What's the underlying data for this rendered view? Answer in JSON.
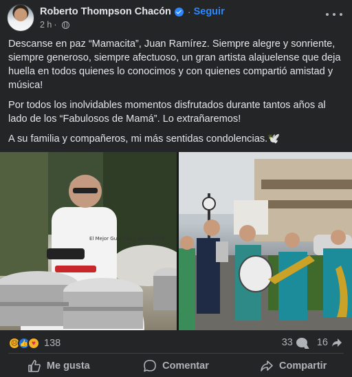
{
  "post": {
    "author": "Roberto Thompson Chacón",
    "follow_label": "Seguir",
    "time": "2 h",
    "separator": "·",
    "paragraphs": [
      "Descanse en paz “Mamacita”, Juan Ramírez. Siempre alegre y sonriente, siempre generoso, siempre afectuoso, un gran artista alajuelense que deja huella en todos quienes lo conocimos y con quienes compartió amistad y música!",
      "Por todos los inolvidables momentos disfrutados durante tantos años al lado de los “Fabulosos de Mamá”.  Lo extrañaremos!",
      "A su familia y compañeros, mi más sentidas condolencias.🕊️"
    ]
  },
  "photos": {
    "left_shirt_text": "El Mejor Guardián Infantil 2020"
  },
  "stats": {
    "reaction_count": "138",
    "comment_count": "33",
    "share_count": "16"
  },
  "actions": {
    "like_label": "Me gusta",
    "comment_label": "Comentar",
    "share_label": "Compartir"
  },
  "icons": {
    "reactions": [
      "sad-face-icon",
      "thumbs-up-icon",
      "care-face-icon"
    ],
    "verified": "verified-badge-icon",
    "audience": "globe-icon",
    "more": "more-options-icon"
  },
  "colors": {
    "background": "#242526",
    "text": "#e4e6eb",
    "secondary_text": "#b0b3b8",
    "accent": "#2d88ff",
    "like_blue": "#1b74e4"
  }
}
